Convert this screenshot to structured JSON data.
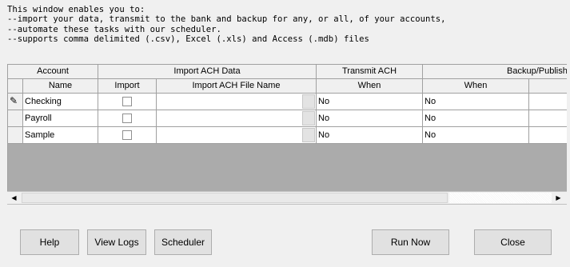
{
  "intro": {
    "line1": "This window enables you to:",
    "line2": "--import your data, transmit to the bank and backup for any, or all, of your accounts,",
    "line3": "--automate these tasks with our scheduler.",
    "line4": "--supports comma delimited (.csv), Excel (.xls) and Access (.mdb) files"
  },
  "grid": {
    "group_headers": {
      "account": "Account",
      "import_ach": "Import ACH Data",
      "transmit": "Transmit ACH",
      "backup": "Backup/Publish"
    },
    "column_headers": {
      "name": "Name",
      "import": "Import",
      "file_name": "Import ACH File Name",
      "transmit_when": "When",
      "backup_when": "When"
    },
    "rows": [
      {
        "name": "Checking",
        "import_checked": false,
        "file": "",
        "transmit_when": "No",
        "backup_when": "No",
        "editing": true
      },
      {
        "name": "Payroll",
        "import_checked": false,
        "file": "",
        "transmit_when": "No",
        "backup_when": "No",
        "editing": false
      },
      {
        "name": "Sample",
        "import_checked": false,
        "file": "",
        "transmit_when": "No",
        "backup_when": "No",
        "editing": false
      }
    ]
  },
  "buttons": {
    "help": "Help",
    "view_logs": "View Logs",
    "scheduler": "Scheduler",
    "run_now": "Run Now",
    "close": "Close"
  }
}
